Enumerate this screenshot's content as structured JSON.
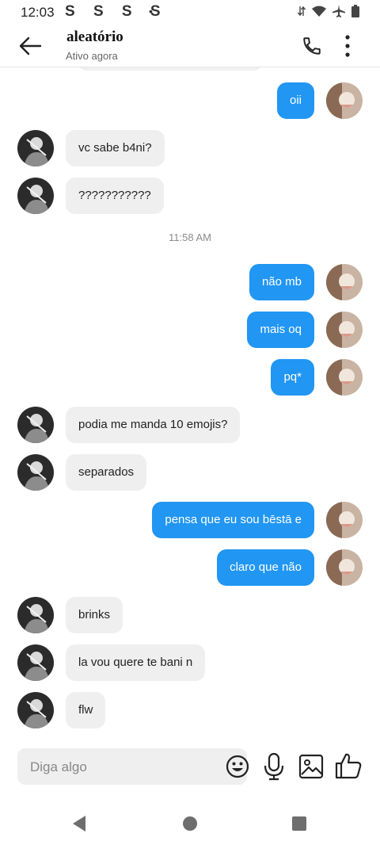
{
  "status_bar": {
    "time": "12:03",
    "notification_icons": "S S S S",
    "extra": "•",
    "icons": [
      "data-arrows-icon",
      "wifi-icon",
      "airplane-icon",
      "battery-icon"
    ]
  },
  "header": {
    "title": "aleatório",
    "subtitle": "Ativo agora",
    "icons": [
      "back-arrow-icon",
      "phone-icon",
      "more-vertical-icon"
    ]
  },
  "messages": [
    {
      "side": "out",
      "text": "oii"
    },
    {
      "side": "in",
      "text": "vc sabe b4ni?"
    },
    {
      "side": "in",
      "text": "???????????"
    },
    {
      "type": "timestamp",
      "text": "11:58 AM"
    },
    {
      "side": "out",
      "text": "não mb"
    },
    {
      "side": "out",
      "text": "mais oq"
    },
    {
      "side": "out",
      "text": "pq*"
    },
    {
      "side": "in",
      "text": "podia me manda 10 emojis?"
    },
    {
      "side": "in",
      "text": "separados"
    },
    {
      "side": "out",
      "text": "pensa que eu sou bēstā e"
    },
    {
      "side": "out",
      "text": "claro que não"
    },
    {
      "side": "in",
      "text": "brinks"
    },
    {
      "side": "in",
      "text": "la vou quere te bani n"
    },
    {
      "side": "in",
      "text": "flw"
    }
  ],
  "composer": {
    "placeholder": "Diga algo",
    "value": "",
    "icons": [
      "emoji-icon",
      "microphone-icon",
      "image-icon",
      "thumbs-up-icon"
    ]
  },
  "nav_bar": {
    "icons": [
      "nav-back-icon",
      "nav-home-icon",
      "nav-recents-icon"
    ]
  },
  "colors": {
    "outgoing_bubble": "#2196f3",
    "incoming_bubble": "#efefef",
    "background": "#ffffff"
  }
}
